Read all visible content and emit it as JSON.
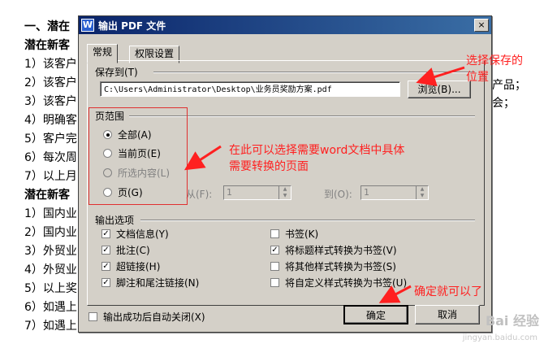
{
  "document": {
    "left_lines": [
      {
        "text": "一、潜在",
        "bold": true
      },
      {
        "text": "潜在新客",
        "bold": true
      },
      {
        "text": "1）该客户",
        "bold": false
      },
      {
        "text": "2）该客户",
        "bold": false
      },
      {
        "text": "3）该客户",
        "bold": false
      },
      {
        "text": "4）明确客",
        "bold": false
      },
      {
        "text": "5）客户完",
        "bold": false
      },
      {
        "text": "6）每次周",
        "bold": false
      },
      {
        "text": "7）以上月",
        "bold": false
      },
      {
        "text": "潜在新客",
        "bold": true
      },
      {
        "text": "1）国内业",
        "bold": false
      },
      {
        "text": "2）国内业",
        "bold": false
      },
      {
        "text": "3）外贸业",
        "bold": false
      },
      {
        "text": "4）外贸业",
        "bold": false
      },
      {
        "text": "5）以上奖",
        "bold": false
      },
      {
        "text": "6）如遇上",
        "bold": false
      },
      {
        "text": "7）如遇上",
        "bold": false
      }
    ],
    "right_fragments": [
      "产品；",
      "会；"
    ]
  },
  "dialog": {
    "title": "输出 PDF 文件",
    "app_icon": "W",
    "close_label": "×",
    "tabs": [
      {
        "label": "常规",
        "active": true
      },
      {
        "label": "权限设置",
        "active": false
      }
    ],
    "save_to": {
      "label": "保存到(T)",
      "path": "C:\\Users\\Administrator\\Desktop\\业务员奖励方案.pdf",
      "browse_label": "浏览(B)..."
    },
    "page_range": {
      "label": "页范围",
      "options": [
        {
          "label": "全部(A)",
          "selected": true,
          "disabled": false
        },
        {
          "label": "当前页(E)",
          "selected": false,
          "disabled": false
        },
        {
          "label": "所选内容(L)",
          "selected": false,
          "disabled": true
        },
        {
          "label": "页(G)",
          "selected": false,
          "disabled": false
        }
      ],
      "from_label": "从(F):",
      "from_value": "1",
      "to_label": "到(O):",
      "to_value": "1"
    },
    "output_options": {
      "label": "输出选项",
      "left": [
        {
          "label": "文档信息(Y)",
          "checked": true
        },
        {
          "label": "批注(C)",
          "checked": true
        },
        {
          "label": "超链接(H)",
          "checked": true
        },
        {
          "label": "脚注和尾注链接(N)",
          "checked": true
        }
      ],
      "right": [
        {
          "label": "书签(K)",
          "checked": false
        },
        {
          "label": "将标题样式转换为书签(V)",
          "checked": true
        },
        {
          "label": "将其他样式转换为书签(S)",
          "checked": false
        },
        {
          "label": "将自定义样式转换为书签(U)",
          "checked": false
        }
      ]
    },
    "auto_close_label": "输出成功后自动关闭(X)",
    "auto_close_checked": false,
    "ok_label": "确定",
    "cancel_label": "取消"
  },
  "annotations": {
    "choose_save_location": [
      "选择保存的",
      "位置"
    ],
    "page_hint": [
      "在此可以选择需要word文档中具体",
      "需要转换的页面"
    ],
    "confirm_hint": "确定就可以了",
    "color": "#ff2020"
  },
  "watermark": {
    "text": "Bai 经验",
    "sub": "jingyan.baidu.com"
  }
}
